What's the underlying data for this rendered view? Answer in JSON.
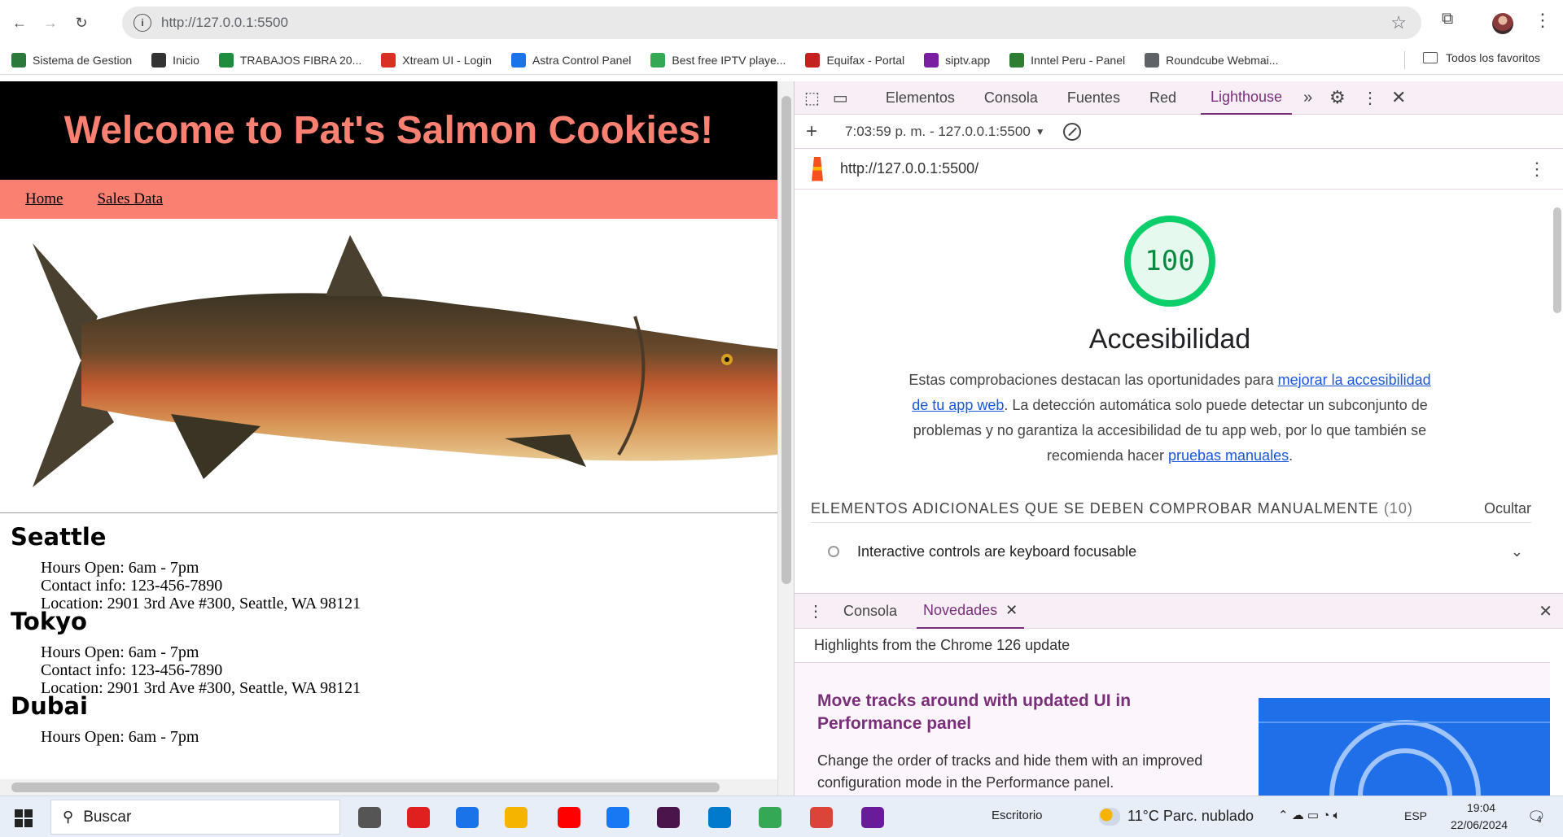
{
  "browser": {
    "url": "http://127.0.0.1:5500",
    "bookmarks": [
      {
        "label": "Sistema de Gestion",
        "color": "#2b7a3b"
      },
      {
        "label": "Inicio",
        "color": "#333333"
      },
      {
        "label": "TRABAJOS FIBRA 20...",
        "color": "#1e8e3e"
      },
      {
        "label": "Xtream UI - Login",
        "color": "#d93025"
      },
      {
        "label": "Astra Control Panel",
        "color": "#1a73e8"
      },
      {
        "label": "Best free IPTV playe...",
        "color": "#34a853"
      },
      {
        "label": "Equifax - Portal",
        "color": "#c5221f"
      },
      {
        "label": "siptv.app",
        "color": "#7b1fa2"
      },
      {
        "label": "Inntel Peru - Panel",
        "color": "#2e7d32"
      },
      {
        "label": "Roundcube Webmai...",
        "color": "#5f6368"
      }
    ],
    "all_bookmarks": "Todos los favoritos"
  },
  "page": {
    "title": "Welcome to Pat's Salmon Cookies!",
    "nav": [
      "Home",
      "Sales Data"
    ],
    "locations": [
      {
        "name": "Seattle",
        "hours": "Hours Open: 6am - 7pm",
        "contact": "Contact info: 123-456-7890",
        "location": "Location: 2901 3rd Ave #300, Seattle, WA 98121"
      },
      {
        "name": "Tokyo",
        "hours": "Hours Open: 6am - 7pm",
        "contact": "Contact info: 123-456-7890",
        "location": "Location: 2901 3rd Ave #300, Seattle, WA 98121"
      },
      {
        "name": "Dubai",
        "hours": "Hours Open: 6am - 7pm",
        "contact": "",
        "location": ""
      }
    ]
  },
  "devtools": {
    "tabs": [
      "Elementos",
      "Consola",
      "Fuentes",
      "Red",
      "Lighthouse"
    ],
    "active_tab": "Lighthouse",
    "report_select": "7:03:59 p. m. - 127.0.0.1:5500",
    "report_url": "http://127.0.0.1:5500/",
    "score": "100",
    "category": "Accesibilidad",
    "desc_1": "Estas comprobaciones destacan las oportunidades para ",
    "desc_link_1": "mejorar la accesibilidad de tu app web",
    "desc_2": ". La detección automática solo puede detectar un subconjunto de problemas y no garantiza la accesibilidad de tu app web, por lo que también se recomienda hacer ",
    "desc_link_2": "pruebas manuales",
    "desc_3": ".",
    "manual_title": "ELEMENTOS ADICIONALES QUE SE DEBEN COMPROBAR MANUALMENTE",
    "manual_count": "(10)",
    "manual_hide": "Ocultar",
    "audit_item": "Interactive controls are keyboard focusable",
    "drawer_tabs": [
      "Consola",
      "Novedades"
    ],
    "drawer_active": "Novedades",
    "highlights": "Highlights from the Chrome 126 update",
    "news_title": "Move tracks around with updated UI in Performance panel",
    "news_text": "Change the order of tracks and hide them with an improved configuration mode in the Performance panel."
  },
  "taskbar": {
    "search": "Buscar",
    "desktop": "Escritorio",
    "weather": "11°C  Parc. nublado",
    "lang": "ESP",
    "time": "19:04",
    "date": "22/06/2024",
    "notif_count": "4"
  }
}
